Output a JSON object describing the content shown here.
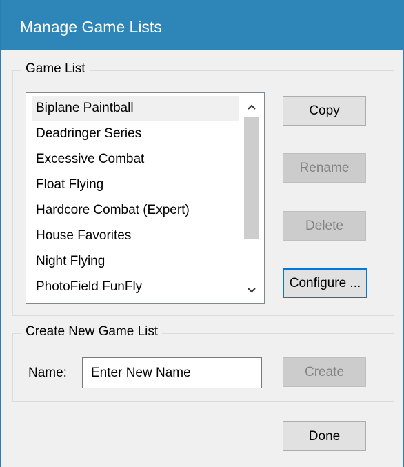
{
  "window": {
    "title": "Manage Game Lists"
  },
  "game_list_group": {
    "legend": "Game List",
    "items": [
      {
        "label": "Biplane Paintball",
        "selected": true
      },
      {
        "label": "Deadringer Series",
        "selected": false
      },
      {
        "label": "Excessive Combat",
        "selected": false
      },
      {
        "label": "Float Flying",
        "selected": false
      },
      {
        "label": "Hardcore Combat (Expert)",
        "selected": false
      },
      {
        "label": "House Favorites",
        "selected": false
      },
      {
        "label": "Night Flying",
        "selected": false
      },
      {
        "label": "PhotoField FunFly",
        "selected": false
      }
    ],
    "scroll_up_glyph": "^",
    "scroll_down_glyph": "v"
  },
  "buttons": {
    "copy": {
      "label": "Copy",
      "enabled": true
    },
    "rename": {
      "label": "Rename",
      "enabled": false
    },
    "delete": {
      "label": "Delete",
      "enabled": false
    },
    "configure": {
      "label": "Configure ...",
      "enabled": true,
      "focused": true
    },
    "create": {
      "label": "Create",
      "enabled": false
    },
    "done": {
      "label": "Done",
      "enabled": true
    }
  },
  "create_group": {
    "legend": "Create New Game List",
    "name_label": "Name:",
    "name_value": "Enter New Name"
  },
  "colors": {
    "titlebar": "#2e86b8",
    "focus_border": "#0078d7",
    "dialog_bg": "#f0f0f0",
    "disabled_text": "#838383"
  }
}
